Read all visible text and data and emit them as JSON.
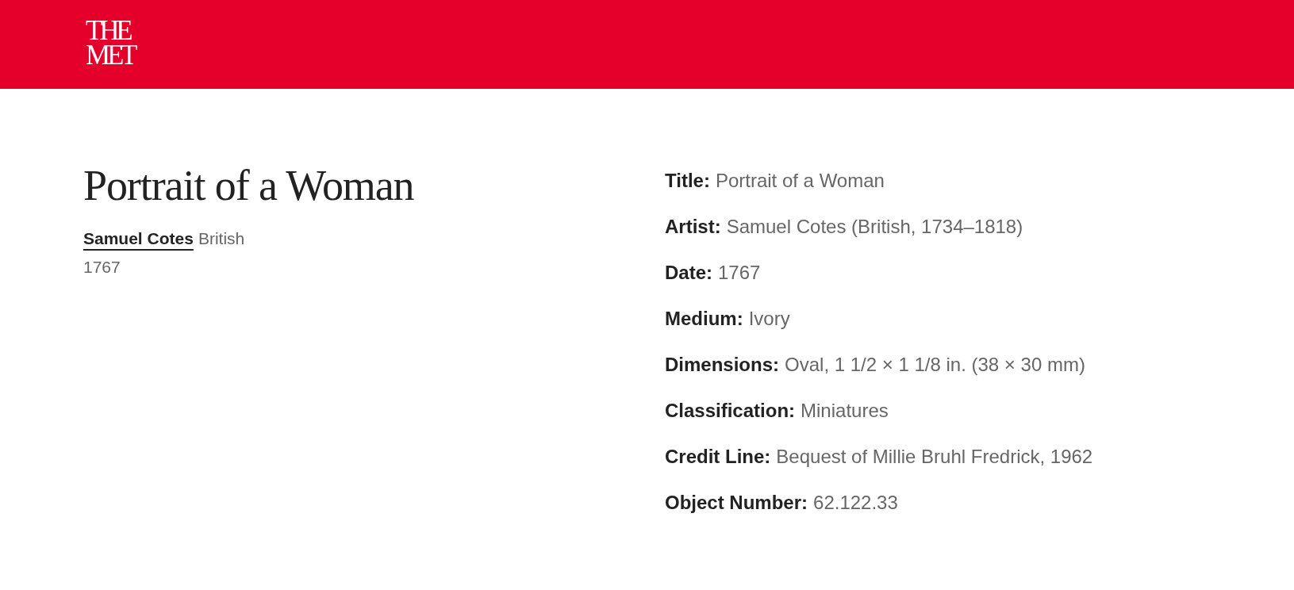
{
  "header": {
    "logo": [
      "THE",
      "MET"
    ]
  },
  "artwork": {
    "title": "Portrait of a Woman",
    "artist_link": "Samuel Cotes",
    "nationality": "British",
    "date": "1767"
  },
  "details": [
    {
      "label": "Title:",
      "value": "Portrait of a Woman"
    },
    {
      "label": "Artist:",
      "value": "Samuel Cotes (British, 1734–1818)"
    },
    {
      "label": "Date:",
      "value": "1767"
    },
    {
      "label": "Medium:",
      "value": "Ivory"
    },
    {
      "label": "Dimensions:",
      "value": "Oval, 1 1/2 × 1 1/8 in. (38 × 30 mm)"
    },
    {
      "label": "Classification:",
      "value": "Miniatures"
    },
    {
      "label": "Credit Line:",
      "value": "Bequest of Millie Bruhl Fredrick, 1962"
    },
    {
      "label": "Object Number:",
      "value": "62.122.33"
    }
  ]
}
